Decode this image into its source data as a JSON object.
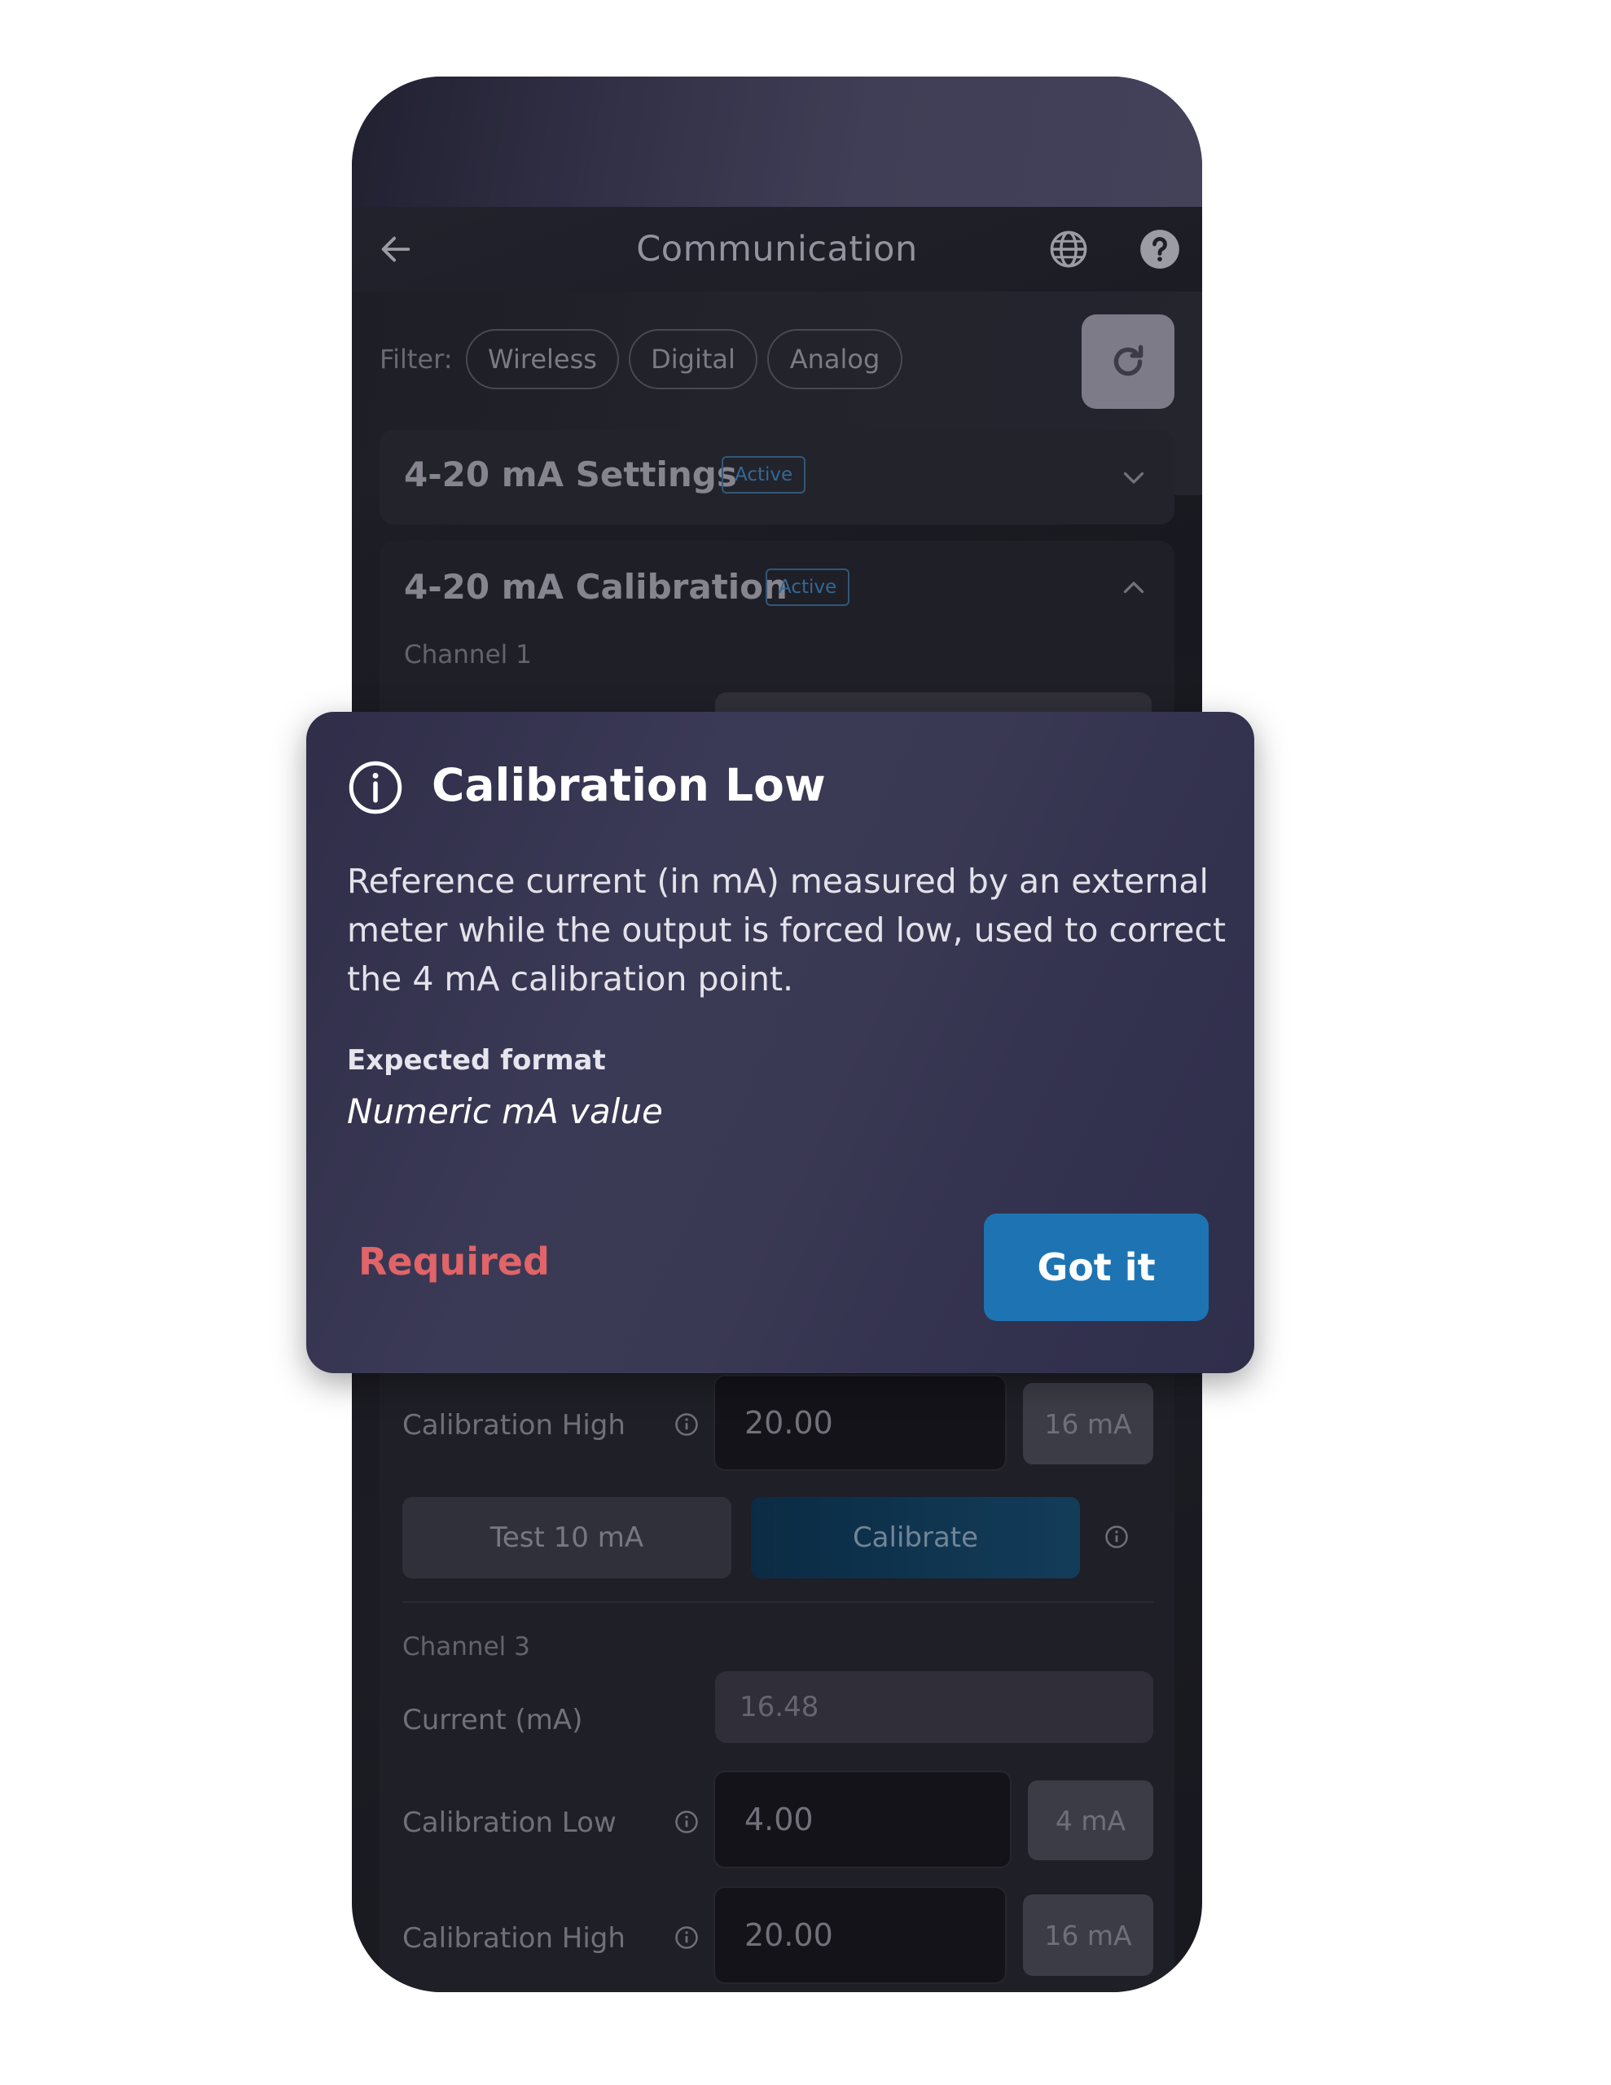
{
  "appbar": {
    "title": "Communication",
    "back_icon": "arrow-left-icon",
    "language_icon": "globe-icon",
    "help_icon": "help-icon"
  },
  "filter": {
    "label": "Filter:",
    "chips": [
      "Wireless",
      "Digital",
      "Analog"
    ],
    "refresh_icon": "refresh-icon"
  },
  "sections": [
    {
      "title": "4-20 mA Settings",
      "badge": "Active",
      "expanded": false
    },
    {
      "title": "4-20 mA Calibration",
      "badge": "Active",
      "expanded": true
    }
  ],
  "calibration": {
    "channel1_label": "Channel 1",
    "channel2": {
      "cal_high_label": "Calibration High",
      "cal_high_value": "20.00",
      "cal_high_unit": "16 mA",
      "test_button": "Test 10 mA",
      "calibrate_button": "Calibrate"
    },
    "channel3": {
      "label": "Channel 3",
      "current_label": "Current (mA)",
      "current_value": "16.48",
      "cal_low_label": "Calibration Low",
      "cal_low_value": "4.00",
      "cal_low_unit": "4 mA",
      "cal_high_label": "Calibration High",
      "cal_high_value": "20.00",
      "cal_high_unit": "16 mA"
    }
  },
  "dialog": {
    "icon": "info-icon",
    "title": "Calibration Low",
    "body": "Reference current (in mA) measured by an external meter while the output is forced low, used to correct the 4 mA calibration point.",
    "format_label": "Expected format",
    "format_value": "Numeric mA value",
    "required_label": "Required",
    "confirm_button": "Got it"
  },
  "colors": {
    "accent": "#1e74b3",
    "badge": "#3f82bb",
    "required": "#e06468"
  }
}
